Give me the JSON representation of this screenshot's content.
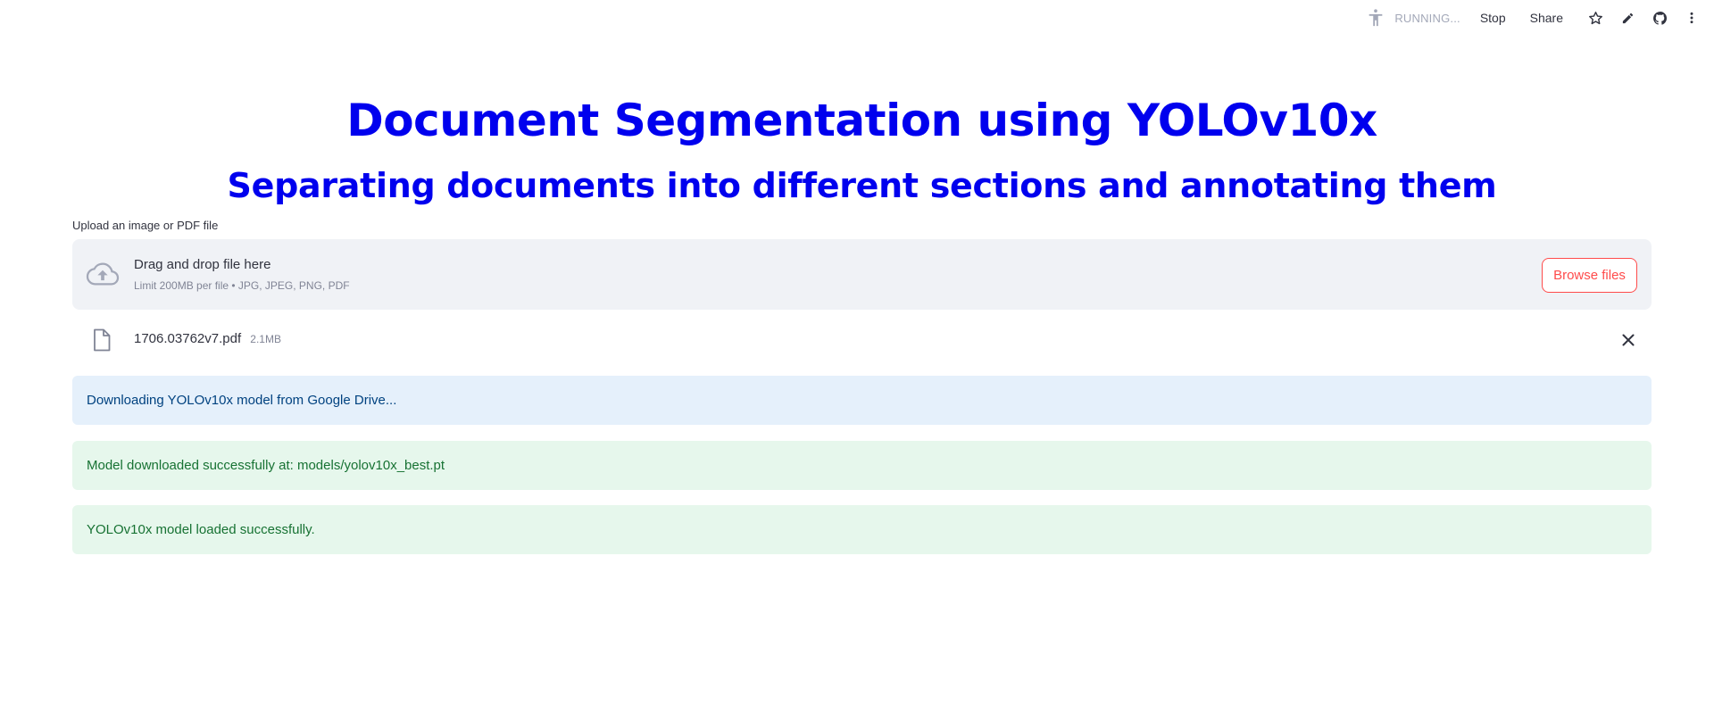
{
  "header": {
    "status_text": "RUNNING...",
    "stop_label": "Stop",
    "share_label": "Share",
    "icons": [
      "running-man-icon",
      "star-icon",
      "pencil-icon",
      "github-icon",
      "more-vert-icon"
    ]
  },
  "main": {
    "title": "Document Segmentation using YOLOv10x",
    "subtitle": "Separating documents into different sections and annotating them",
    "title_color": "#0000ee"
  },
  "uploader": {
    "label": "Upload an image or PDF file",
    "drop_title": "Drag and drop file here",
    "drop_subtitle": "Limit 200MB per file • JPG, JPEG, PNG, PDF",
    "browse_label": "Browse files",
    "accent_color": "#ff4b4b"
  },
  "uploaded_file": {
    "name": "1706.03762v7.pdf",
    "size": "2.1MB"
  },
  "messages": [
    {
      "kind": "info",
      "text": "Downloading YOLOv10x model from Google Drive..."
    },
    {
      "kind": "success",
      "text": "Model downloaded successfully at: models/yolov10x_best.pt"
    },
    {
      "kind": "success",
      "text": "YOLOv10x model loaded successfully."
    }
  ]
}
